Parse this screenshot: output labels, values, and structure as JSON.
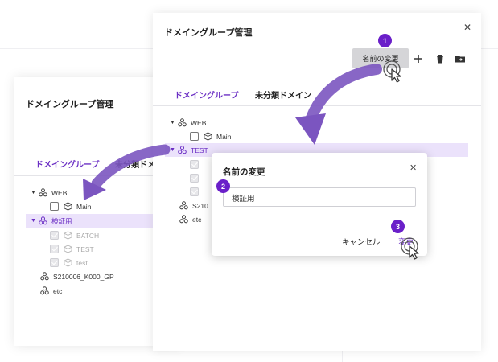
{
  "back_panel": {
    "title": "ドメイングループ管理",
    "tabs": [
      "ドメイングループ",
      "未分類ドメイン"
    ],
    "tree": {
      "web": "WEB",
      "main": "Main",
      "selected": "検証用",
      "children": [
        "BATCH",
        "TEST",
        "test"
      ],
      "s_group": "S210006_K000_GP",
      "etc": "etc"
    }
  },
  "front_panel": {
    "title": "ドメイングループ管理",
    "rename_button": "名前の変更",
    "tabs": [
      "ドメイングループ",
      "未分類ドメイン"
    ],
    "tree": {
      "web": "WEB",
      "main": "Main",
      "selected": "TEST",
      "s_group_partial": "S210",
      "etc": "etc"
    }
  },
  "dialog": {
    "title": "名前の変更",
    "input_value": "検証用",
    "cancel": "キャンセル",
    "confirm": "変更"
  },
  "steps": [
    "1",
    "2",
    "3"
  ],
  "colors": {
    "accent": "#6b2fc4",
    "badge": "#6a1fc9",
    "selected_bg": "#ebe2fb",
    "arrow": "#7b55c0"
  }
}
